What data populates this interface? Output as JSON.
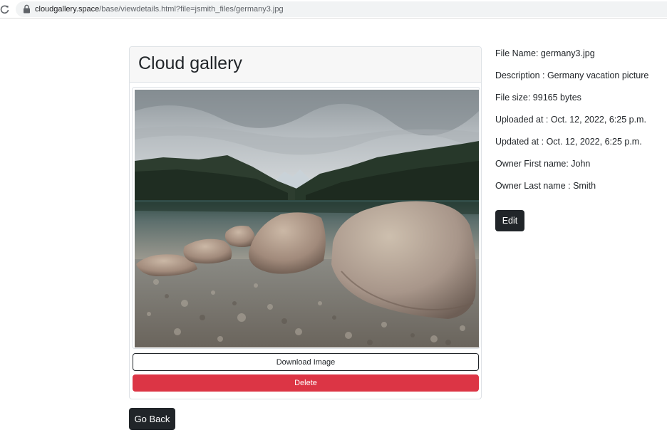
{
  "browser": {
    "url_host": "cloudgallery.space",
    "url_path": "/base/viewdetails.html?file=jsmith_files/germany3.jpg"
  },
  "card": {
    "title": "Cloud gallery",
    "download_label": "Download Image",
    "delete_label": "Delete"
  },
  "back_label": "Go Back",
  "details": [
    "File Name: germany3.jpg",
    "Description : Germany vacation picture",
    "File size: 99165 bytes",
    "Uploaded at : Oct. 12, 2022, 6:25 p.m.",
    "Updated at : Oct. 12, 2022, 6:25 p.m.",
    "Owner First name: John",
    "Owner Last name : Smith"
  ],
  "edit_label": "Edit",
  "colors": {
    "danger": "#dc3545",
    "dark": "#212529",
    "header_bg": "#f7f7f7"
  }
}
